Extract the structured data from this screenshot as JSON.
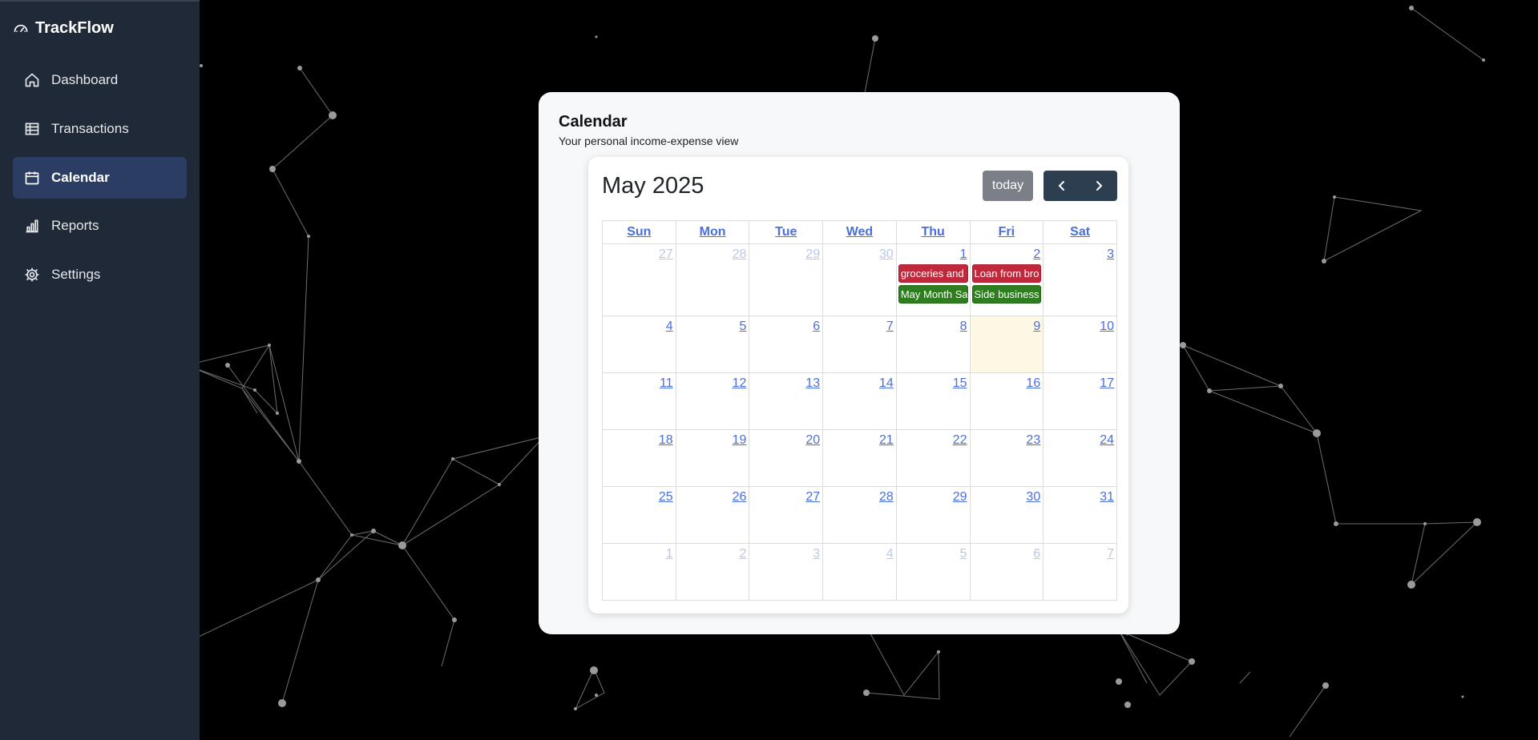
{
  "app": {
    "name": "TrackFlow"
  },
  "sidebar": {
    "items": [
      {
        "label": "Dashboard",
        "icon": "home-icon",
        "active": false
      },
      {
        "label": "Transactions",
        "icon": "table-icon",
        "active": false
      },
      {
        "label": "Calendar",
        "icon": "calendar-icon",
        "active": true
      },
      {
        "label": "Reports",
        "icon": "bar-chart-icon",
        "active": false
      },
      {
        "label": "Settings",
        "icon": "gear-icon",
        "active": false
      }
    ]
  },
  "page": {
    "title": "Calendar",
    "subtitle": "Your personal income-expense view"
  },
  "calendar": {
    "month_title": "May 2025",
    "today_label": "today",
    "weekdays": [
      "Sun",
      "Mon",
      "Tue",
      "Wed",
      "Thu",
      "Fri",
      "Sat"
    ],
    "weeks": [
      [
        "27",
        "28",
        "29",
        "30",
        "1",
        "2",
        "3"
      ],
      [
        "4",
        "5",
        "6",
        "7",
        "8",
        "9",
        "10"
      ],
      [
        "11",
        "12",
        "13",
        "14",
        "15",
        "16",
        "17"
      ],
      [
        "18",
        "19",
        "20",
        "21",
        "22",
        "23",
        "24"
      ],
      [
        "25",
        "26",
        "27",
        "28",
        "29",
        "30",
        "31"
      ],
      [
        "1",
        "2",
        "3",
        "4",
        "5",
        "6",
        "7"
      ]
    ],
    "events": [
      {
        "label": "groceries and",
        "type": "expense",
        "day": "1"
      },
      {
        "label": "May Month Sa",
        "type": "income",
        "day": "1"
      },
      {
        "label": "Loan from bro",
        "type": "expense",
        "day": "2"
      },
      {
        "label": "Side business",
        "type": "income",
        "day": "2"
      }
    ]
  },
  "colors": {
    "sidebar_bg": "#1f2937",
    "active_item_bg": "#2b3d63",
    "expense": "#c0283b",
    "income": "#2e7d1f",
    "today_highlight": "#fcf8e3",
    "link": "#4a6fdc"
  }
}
